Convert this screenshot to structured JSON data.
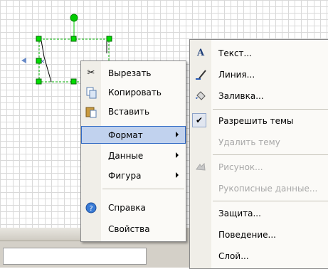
{
  "context_menu": {
    "items": [
      {
        "label": "Вырезать",
        "icon": "scissors-icon"
      },
      {
        "label": "Копировать",
        "icon": "copy-icon"
      },
      {
        "label": "Вставить",
        "icon": "paste-icon"
      },
      {
        "label": "Формат",
        "submenu": true,
        "selected": true
      },
      {
        "label": "Данные",
        "submenu": true
      },
      {
        "label": "Фигура",
        "submenu": true
      },
      {
        "label": "Справка",
        "icon": "help-icon"
      },
      {
        "label": "Свойства"
      }
    ]
  },
  "format_submenu": {
    "items": [
      {
        "label": "Текст...",
        "icon": "text-format-icon"
      },
      {
        "label": "Линия...",
        "icon": "line-format-icon"
      },
      {
        "label": "Заливка...",
        "icon": "fill-bucket-icon"
      },
      {
        "label": "Разрешить темы",
        "checked": true
      },
      {
        "label": "Удалить тему",
        "disabled": true
      },
      {
        "label": "Рисунок...",
        "disabled": true,
        "icon": "picture-icon"
      },
      {
        "label": "Рукописные данные...",
        "disabled": true
      },
      {
        "label": "Защита..."
      },
      {
        "label": "Поведение..."
      },
      {
        "label": "Слой..."
      }
    ]
  },
  "colors": {
    "selection_fill": "#c1d2ee",
    "selection_border": "#316ac5",
    "handle_green": "#00cc00",
    "grid": "#d9d9d9"
  }
}
